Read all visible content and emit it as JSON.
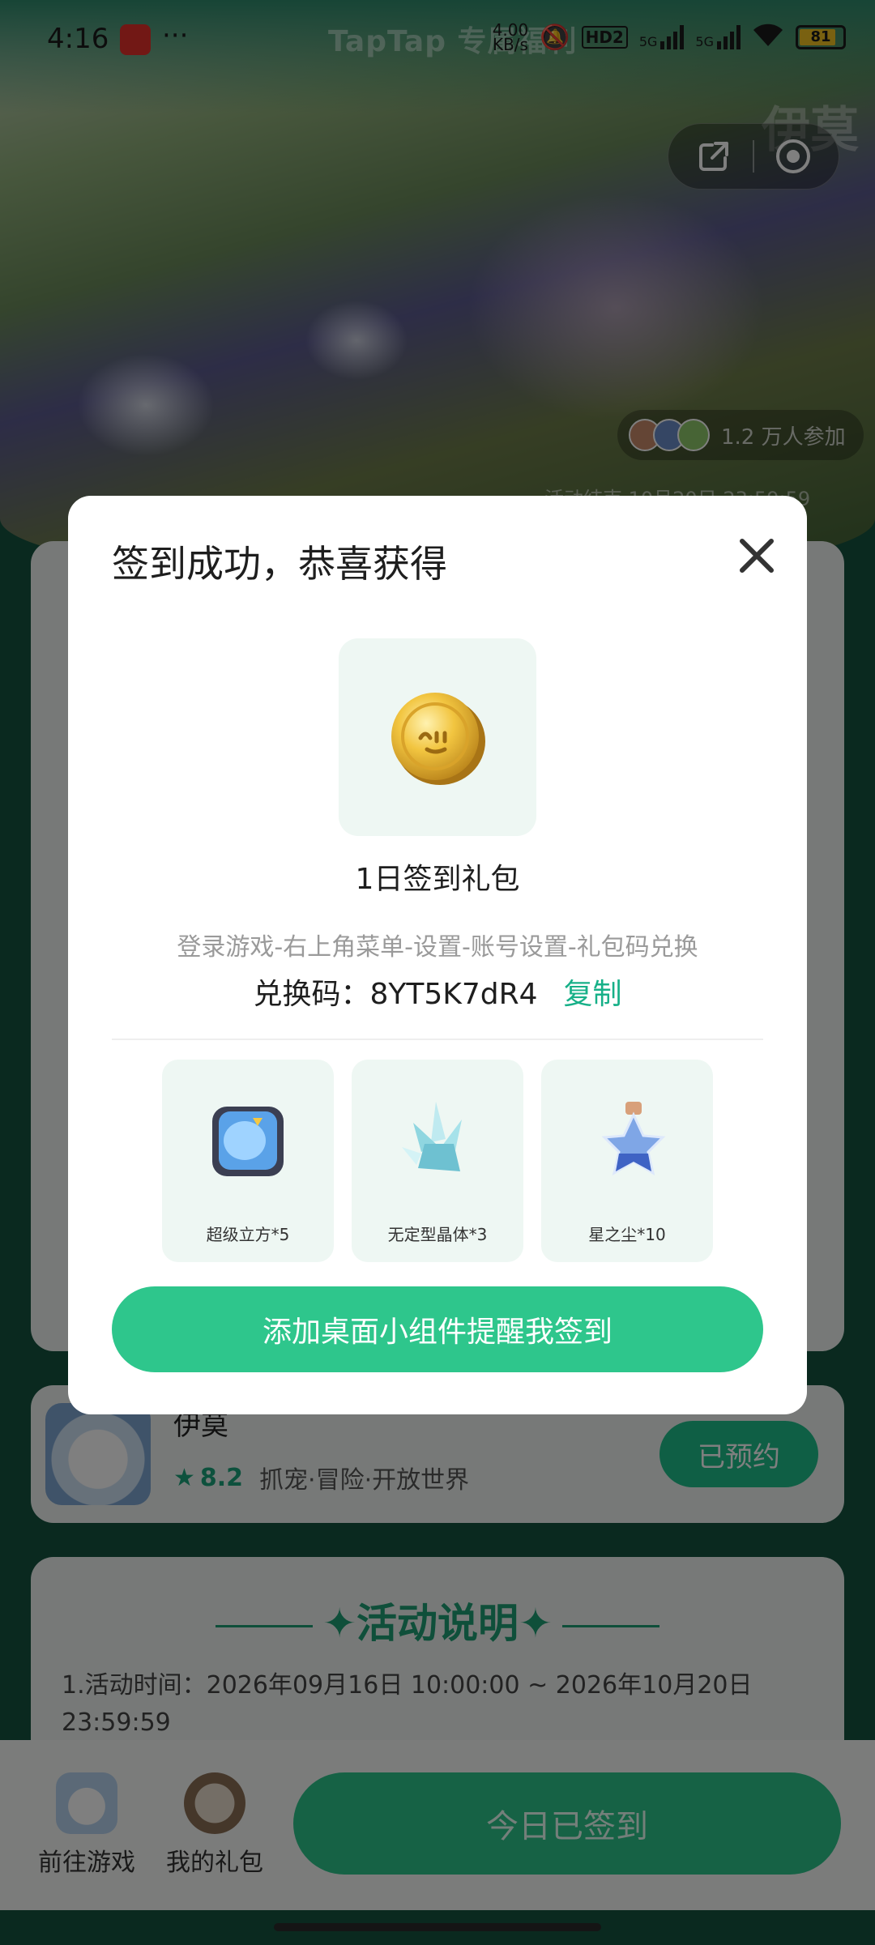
{
  "status_bar": {
    "time": "4:16",
    "dots": "···",
    "network_speed": "KB/s",
    "network_value": "4.00",
    "hd_label": "HD2",
    "net1": "5G",
    "net2": "5G",
    "battery": "81"
  },
  "hero": {
    "banner_text": "TapTap 专属福利",
    "corner_title": "伊莫",
    "participants": "1.2 万人参加",
    "end_time": "活动结束 10月20日 23:59:59"
  },
  "game_card": {
    "name": "伊莫",
    "score": "8.2",
    "tags": "抓宠·冒险·开放世界",
    "reserve_button": "已预约"
  },
  "description": {
    "title": "活动说明",
    "text": "1.活动时间：2026年09月16日 10:00:00 ~ 2026年10月20日 23:59:59"
  },
  "bottom_bar": {
    "go_game": "前往游戏",
    "my_gift": "我的礼包",
    "signed_button": "今日已签到"
  },
  "modal": {
    "title": "签到成功，恭喜获得",
    "reward_name": "1日签到礼包",
    "howto": "登录游戏-右上角菜单-设置-账号设置-礼包码兑换",
    "code_label": "兑换码：8YT5K7dR4",
    "copy_label": "复制",
    "items": [
      {
        "label": "超级立方*5",
        "icon": "super-cube-icon"
      },
      {
        "label": "无定型晶体*3",
        "icon": "crystal-icon"
      },
      {
        "label": "星之尘*10",
        "icon": "stardust-bottle-icon"
      }
    ],
    "widget_button": "添加桌面小组件提醒我签到"
  },
  "colors": {
    "accent": "#2ec68c",
    "copy_link": "#17b088",
    "reward_bg": "#eef7f3"
  }
}
